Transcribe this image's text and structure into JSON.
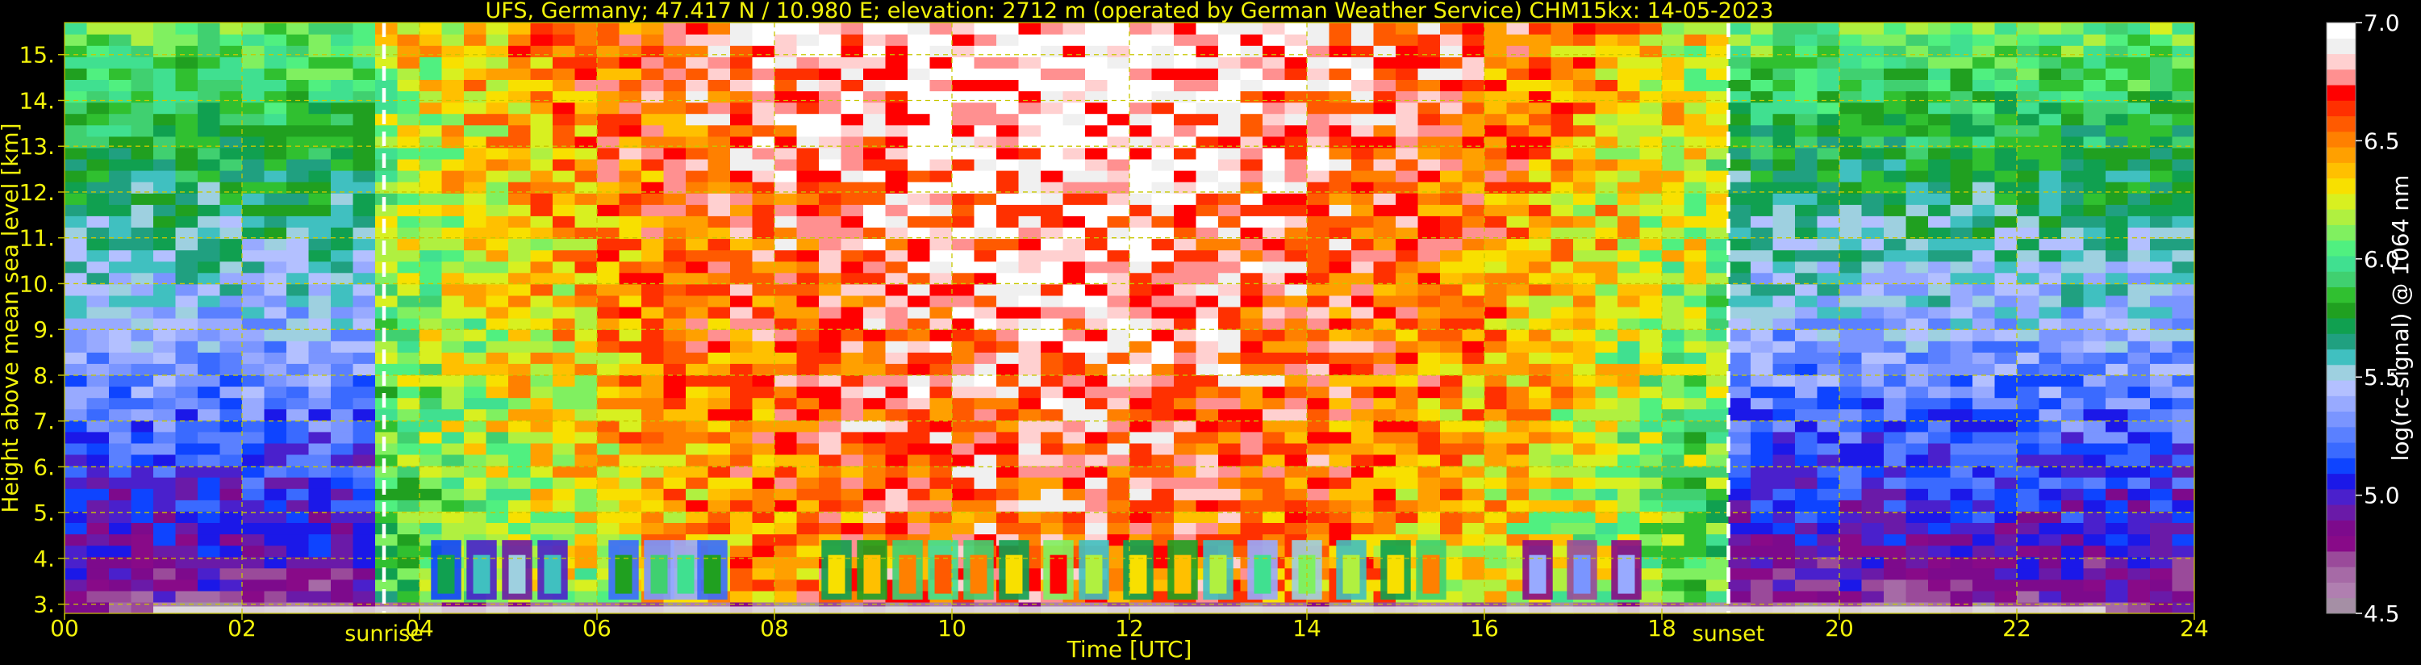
{
  "chart_data": {
    "type": "heatmap",
    "title": "UFS, Germany; 47.417 N / 10.980 E; elevation: 2712 m  (operated by German Weather Service)    CHM15kx: 14-05-2023",
    "xlabel": "Time [UTC]",
    "ylabel": "Height above mean sea level [km]",
    "xlim": [
      0,
      24
    ],
    "ylim": [
      2.8,
      15.7
    ],
    "x_ticks": [
      "00",
      "02",
      "04",
      "06",
      "08",
      "10",
      "12",
      "14",
      "16",
      "18",
      "20",
      "22",
      "24"
    ],
    "y_ticks": [
      "3.",
      "4.",
      "5.",
      "6.",
      "7.",
      "8.",
      "9.",
      "10.",
      "11.",
      "12.",
      "13.",
      "14.",
      "15."
    ],
    "grid": true,
    "markers": [
      {
        "label": "sunrise",
        "x": 3.6
      },
      {
        "label": "sunset",
        "x": 18.75
      }
    ],
    "colorbar": {
      "label": "log(rc-signal) @ 1064 nm",
      "range": [
        4.5,
        7.0
      ],
      "ticks": [
        "4.5",
        "5.0",
        "5.5",
        "6.0",
        "6.5",
        "7.0"
      ],
      "colors": [
        "#a58fa5",
        "#b07fb0",
        "#a66aa6",
        "#9a4a9a",
        "#880a88",
        "#7d0a8c",
        "#6a1aa8",
        "#4a20cc",
        "#1b18e8",
        "#0e44ff",
        "#3a6aff",
        "#5a80ff",
        "#7a95ff",
        "#98aaff",
        "#b3c0ff",
        "#9ed0e0",
        "#40c0c0",
        "#20a080",
        "#10a050",
        "#20a020",
        "#30c030",
        "#40d070",
        "#40e090",
        "#50f080",
        "#80f060",
        "#b0f040",
        "#d8f020",
        "#f8e000",
        "#ffc000",
        "#ffa000",
        "#ff8000",
        "#ff5a00",
        "#ff3000",
        "#ff0000",
        "#ff9090",
        "#ffd0d0",
        "#f0f0f0",
        "#ffffff"
      ]
    },
    "low_cloud_layer": {
      "height_km": [
        3.1,
        4.4
      ],
      "events": [
        {
          "t": 4.3,
          "v": 5.7
        },
        {
          "t": 4.7,
          "v": 5.6
        },
        {
          "t": 5.1,
          "v": 5.5
        },
        {
          "t": 5.5,
          "v": 5.6
        },
        {
          "t": 6.3,
          "v": 5.8
        },
        {
          "t": 6.7,
          "v": 5.9
        },
        {
          "t": 7.0,
          "v": 6.0
        },
        {
          "t": 7.3,
          "v": 5.8
        },
        {
          "t": 8.7,
          "v": 6.3
        },
        {
          "t": 9.1,
          "v": 6.4
        },
        {
          "t": 9.5,
          "v": 6.5
        },
        {
          "t": 9.9,
          "v": 6.6
        },
        {
          "t": 10.3,
          "v": 6.5
        },
        {
          "t": 10.7,
          "v": 6.3
        },
        {
          "t": 11.2,
          "v": 6.7
        },
        {
          "t": 11.6,
          "v": 6.2
        },
        {
          "t": 12.1,
          "v": 6.3
        },
        {
          "t": 12.6,
          "v": 6.4
        },
        {
          "t": 13.0,
          "v": 6.2
        },
        {
          "t": 13.5,
          "v": 6.0
        },
        {
          "t": 14.0,
          "v": 6.1
        },
        {
          "t": 14.5,
          "v": 6.2
        },
        {
          "t": 15.0,
          "v": 6.3
        },
        {
          "t": 15.4,
          "v": 6.5
        },
        {
          "t": 16.6,
          "v": 5.4
        },
        {
          "t": 17.1,
          "v": 5.3
        },
        {
          "t": 17.6,
          "v": 5.4
        }
      ]
    }
  }
}
